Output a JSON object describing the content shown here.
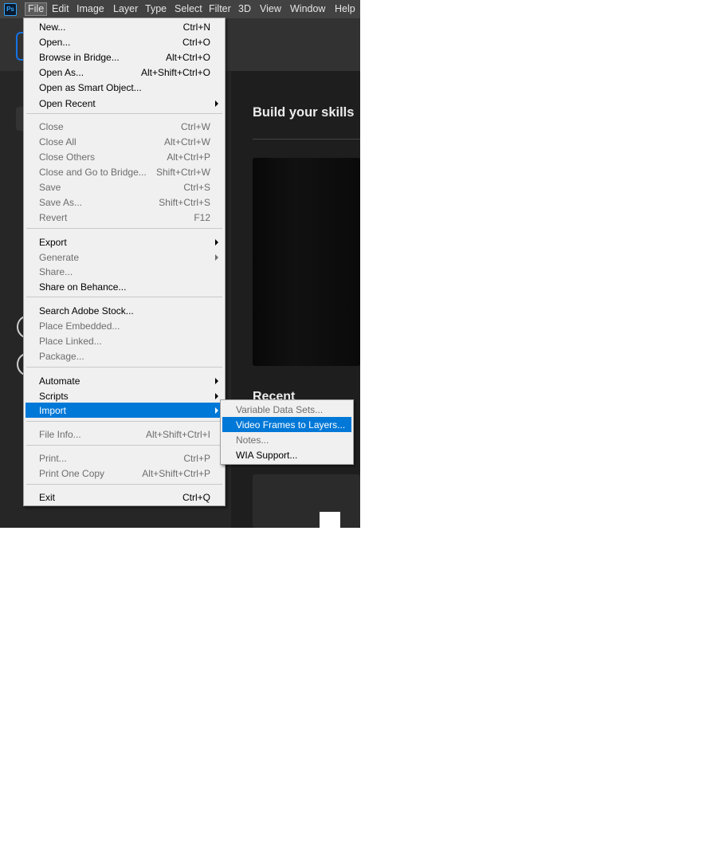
{
  "menubar": {
    "logo": "Ps",
    "items": [
      "File",
      "Edit",
      "Image",
      "Layer",
      "Type",
      "Select",
      "Filter",
      "3D",
      "View",
      "Window",
      "Help"
    ]
  },
  "background": {
    "build_title": "Build your skills",
    "recent_title": "Recent"
  },
  "file_menu": {
    "items": [
      {
        "label": "New...",
        "shortcut": "Ctrl+N",
        "enabled": true
      },
      {
        "label": "Open...",
        "shortcut": "Ctrl+O",
        "enabled": true
      },
      {
        "label": "Browse in Bridge...",
        "shortcut": "Alt+Ctrl+O",
        "enabled": true
      },
      {
        "label": "Open As...",
        "shortcut": "Alt+Shift+Ctrl+O",
        "enabled": true
      },
      {
        "label": "Open as Smart Object...",
        "shortcut": "",
        "enabled": true
      },
      {
        "label": "Open Recent",
        "shortcut": "",
        "enabled": true,
        "submenu": true
      },
      {
        "label": "Close",
        "shortcut": "Ctrl+W",
        "enabled": false
      },
      {
        "label": "Close All",
        "shortcut": "Alt+Ctrl+W",
        "enabled": false
      },
      {
        "label": "Close Others",
        "shortcut": "Alt+Ctrl+P",
        "enabled": false
      },
      {
        "label": "Close and Go to Bridge...",
        "shortcut": "Shift+Ctrl+W",
        "enabled": false
      },
      {
        "label": "Save",
        "shortcut": "Ctrl+S",
        "enabled": false
      },
      {
        "label": "Save As...",
        "shortcut": "Shift+Ctrl+S",
        "enabled": false
      },
      {
        "label": "Revert",
        "shortcut": "F12",
        "enabled": false
      },
      {
        "label": "Export",
        "shortcut": "",
        "enabled": true,
        "submenu": true
      },
      {
        "label": "Generate",
        "shortcut": "",
        "enabled": false,
        "submenu": true
      },
      {
        "label": "Share...",
        "shortcut": "",
        "enabled": false
      },
      {
        "label": "Share on Behance...",
        "shortcut": "",
        "enabled": true
      },
      {
        "label": "Search Adobe Stock...",
        "shortcut": "",
        "enabled": true
      },
      {
        "label": "Place Embedded...",
        "shortcut": "",
        "enabled": false
      },
      {
        "label": "Place Linked...",
        "shortcut": "",
        "enabled": false
      },
      {
        "label": "Package...",
        "shortcut": "",
        "enabled": false
      },
      {
        "label": "Automate",
        "shortcut": "",
        "enabled": true,
        "submenu": true
      },
      {
        "label": "Scripts",
        "shortcut": "",
        "enabled": true,
        "submenu": true
      },
      {
        "label": "Import",
        "shortcut": "",
        "enabled": true,
        "submenu": true,
        "highlighted": true
      },
      {
        "label": "File Info...",
        "shortcut": "Alt+Shift+Ctrl+I",
        "enabled": false
      },
      {
        "label": "Print...",
        "shortcut": "Ctrl+P",
        "enabled": false
      },
      {
        "label": "Print One Copy",
        "shortcut": "Alt+Shift+Ctrl+P",
        "enabled": false
      },
      {
        "label": "Exit",
        "shortcut": "Ctrl+Q",
        "enabled": true
      }
    ]
  },
  "import_submenu": {
    "items": [
      {
        "label": "Variable Data Sets...",
        "enabled": false
      },
      {
        "label": "Video Frames to Layers...",
        "enabled": true,
        "highlighted": true
      },
      {
        "label": "Notes...",
        "enabled": false
      },
      {
        "label": "WIA Support...",
        "enabled": true
      }
    ]
  },
  "colors": {
    "highlight": "#0078d7",
    "menu_bg": "#f0f0f0",
    "menubar_bg": "#424242",
    "app_bg": "#1e1e1e"
  }
}
